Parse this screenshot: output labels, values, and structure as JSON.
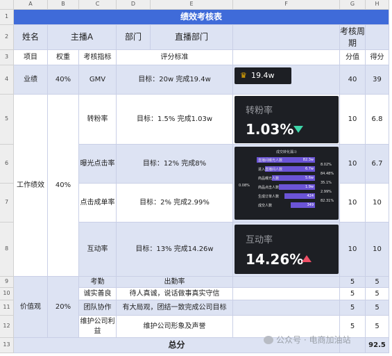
{
  "columns": [
    "A",
    "B",
    "C",
    "D",
    "E",
    "F",
    "G",
    "H"
  ],
  "rows": [
    "1",
    "2",
    "3",
    "4",
    "5",
    "6",
    "7",
    "8",
    "9",
    "10",
    "11",
    "12",
    "13"
  ],
  "title": "绩效考核表",
  "row2": {
    "name_label": "姓名",
    "name_value": "主播A",
    "dept_label": "部门",
    "dept_value": "直播部门",
    "period_label": "考核周期"
  },
  "row3": {
    "item": "项目",
    "weight": "权重",
    "indicator": "考核指标",
    "standard": "评分标准",
    "score_value": "分值",
    "score_got": "得分"
  },
  "performance": {
    "item": "业绩",
    "weight": "40%",
    "indicator": "GMV",
    "standard": "目标：20w   完成19.4w",
    "value": "40",
    "score": "39",
    "kpi": "19.4w"
  },
  "work": {
    "item": "工作绩效",
    "weight": "40%",
    "rows": [
      {
        "indicator": "转粉率",
        "standard": "目标：1.5%   完成1.03w",
        "value": "10",
        "score": "6.8"
      },
      {
        "indicator": "曝光点击率",
        "standard": "目标：12%   完成8%",
        "value": "10",
        "score": "6.7"
      },
      {
        "indicator": "点击成单率",
        "standard": "目标：2%   完成2.99%",
        "value": "10",
        "score": "10"
      },
      {
        "indicator": "互动率",
        "standard": "目标：13%   完成14.26w",
        "value": "10",
        "score": "10"
      }
    ]
  },
  "kpi_fans": {
    "label": "转粉率",
    "value": "1.03%"
  },
  "kpi_interact": {
    "label": "互动率",
    "value": "14.26%"
  },
  "funnel": {
    "title": "成交转化漏斗",
    "left_rate": "0.08%",
    "stages": [
      {
        "label": "直播间曝光人数",
        "value": "82.3w",
        "fill": 1.0
      },
      {
        "label": "进入直播间人数",
        "value": "6.7w",
        "fill": 0.86
      },
      {
        "label": "商品曝光人数",
        "value": "5.6w",
        "fill": 0.74
      },
      {
        "label": "商品点击人数",
        "value": "1.9w",
        "fill": 0.62
      },
      {
        "label": "生成订单人数",
        "value": "424",
        "fill": 0.52
      },
      {
        "label": "成交人数",
        "value": "349",
        "fill": 0.42
      }
    ],
    "rates": [
      "8.02%",
      "84.48%",
      "35.1%",
      "2.99%",
      "82.31%"
    ]
  },
  "values": {
    "item": "价值观",
    "weight": "20%",
    "rows": [
      {
        "indicator": "考勤",
        "standard": "出勤率",
        "value": "5",
        "score": "5"
      },
      {
        "indicator": "诚实善良",
        "standard": "待人真诚，说话做事真实守信",
        "value": "5",
        "score": "5"
      },
      {
        "indicator": "团队协作",
        "standard": "有大局观，团结一致完成公司目标",
        "value": "5",
        "score": "5"
      },
      {
        "indicator": "维护公司利益",
        "standard": "维护公司形象及声誉",
        "value": "5",
        "score": "5"
      }
    ]
  },
  "total": {
    "label": "总分",
    "value": "92.5"
  },
  "watermark": "公众号 · 电商加油站",
  "colors": {
    "title_bg": "#3f6bd9",
    "light_fill": "#dde3f3",
    "dark_panel": "#1d1f24",
    "down": "#3ed6a9",
    "up": "#ee4f66",
    "funnel": "#6b54d6"
  }
}
